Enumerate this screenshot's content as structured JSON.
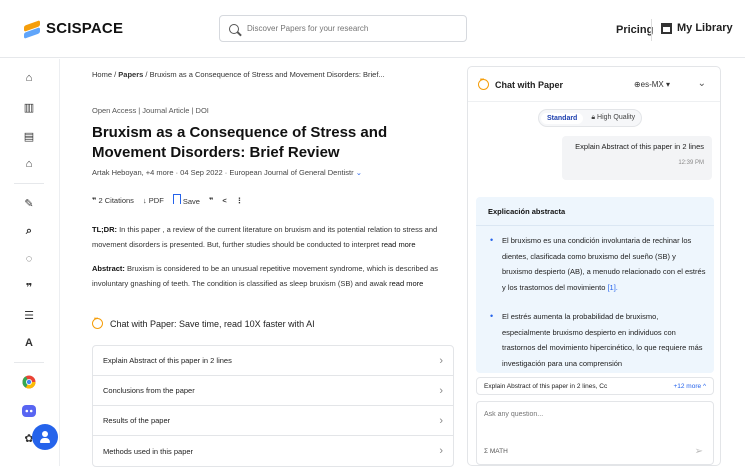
{
  "header": {
    "brand": "SCISPACE",
    "search_placeholder": "Discover Papers for your research",
    "pricing": "Pricing",
    "my_library": "My Library"
  },
  "rail": {
    "icons": [
      "home-icon",
      "library-icon",
      "notebook-icon",
      "graduation-icon",
      "pen-icon",
      "search-icon",
      "chat-icon",
      "quote-icon",
      "list-icon",
      "translate-icon",
      "chrome-icon",
      "discord-icon",
      "openai-icon"
    ]
  },
  "breadcrumb": {
    "home": "Home",
    "papers": "Papers",
    "current": "Bruxism as a Consequence of Stress and Movement Disorders: Brief..."
  },
  "paper": {
    "tags": "Open Access | Journal Article | DOI",
    "title": "Bruxism as a Consequence of Stress and Movement Disorders: Brief Review",
    "authors": "Artak Heboyan, +4 more · 04 Sep 2022 · European Journal of General Dentistr",
    "citations": "2 Citations",
    "pdf": "PDF",
    "save": "Save",
    "tldr_label": "TL;DR:",
    "tldr_text": "In this paper , a review of the current literature on bruxism and its potential relation to stress and movement disorders is presented. But, further studies should be conducted to interpret",
    "read_more": "read more",
    "abstract_label": "Abstract:",
    "abstract_text": "Bruxism is considered to be an unusual repetitive movement syndrome, which is described as involuntary gnashing of teeth. The condition is classified as sleep bruxism (SB) and awak"
  },
  "cta": {
    "text": "Chat with Paper: Save time, read 10X faster with AI"
  },
  "questions": [
    "Explain Abstract of this paper in 2 lines",
    "Conclusions from the paper",
    "Results of the paper",
    "Methods used in this paper"
  ],
  "chat": {
    "title": "Chat with Paper",
    "language": "es-MX",
    "mode_standard": "Standard",
    "mode_hq": "High Quality",
    "user_msg": "Explain Abstract of this paper in 2 lines",
    "user_time": "12:39 PM",
    "answer_title": "Explicación abstracta",
    "bullet1": "El bruxismo es una condición involuntaria de rechinar los dientes, clasificada como bruxismo del sueño (SB) y bruxismo despierto (AB), a menudo relacionado con el estrés y los trastornos del movimiento",
    "bullet1_cite": "[1].",
    "bullet2": "El estrés aumenta la probabilidad de bruxismo, especialmente bruxismo despierto en individuos con trastornos del movimiento hipercinético, lo que requiere más investigación para una comprensión",
    "suggest": "Explain Abstract of this paper in 2 lines, Cc",
    "suggest_more": "+12 more",
    "ask_placeholder": "Ask any question...",
    "math": "MATH"
  }
}
